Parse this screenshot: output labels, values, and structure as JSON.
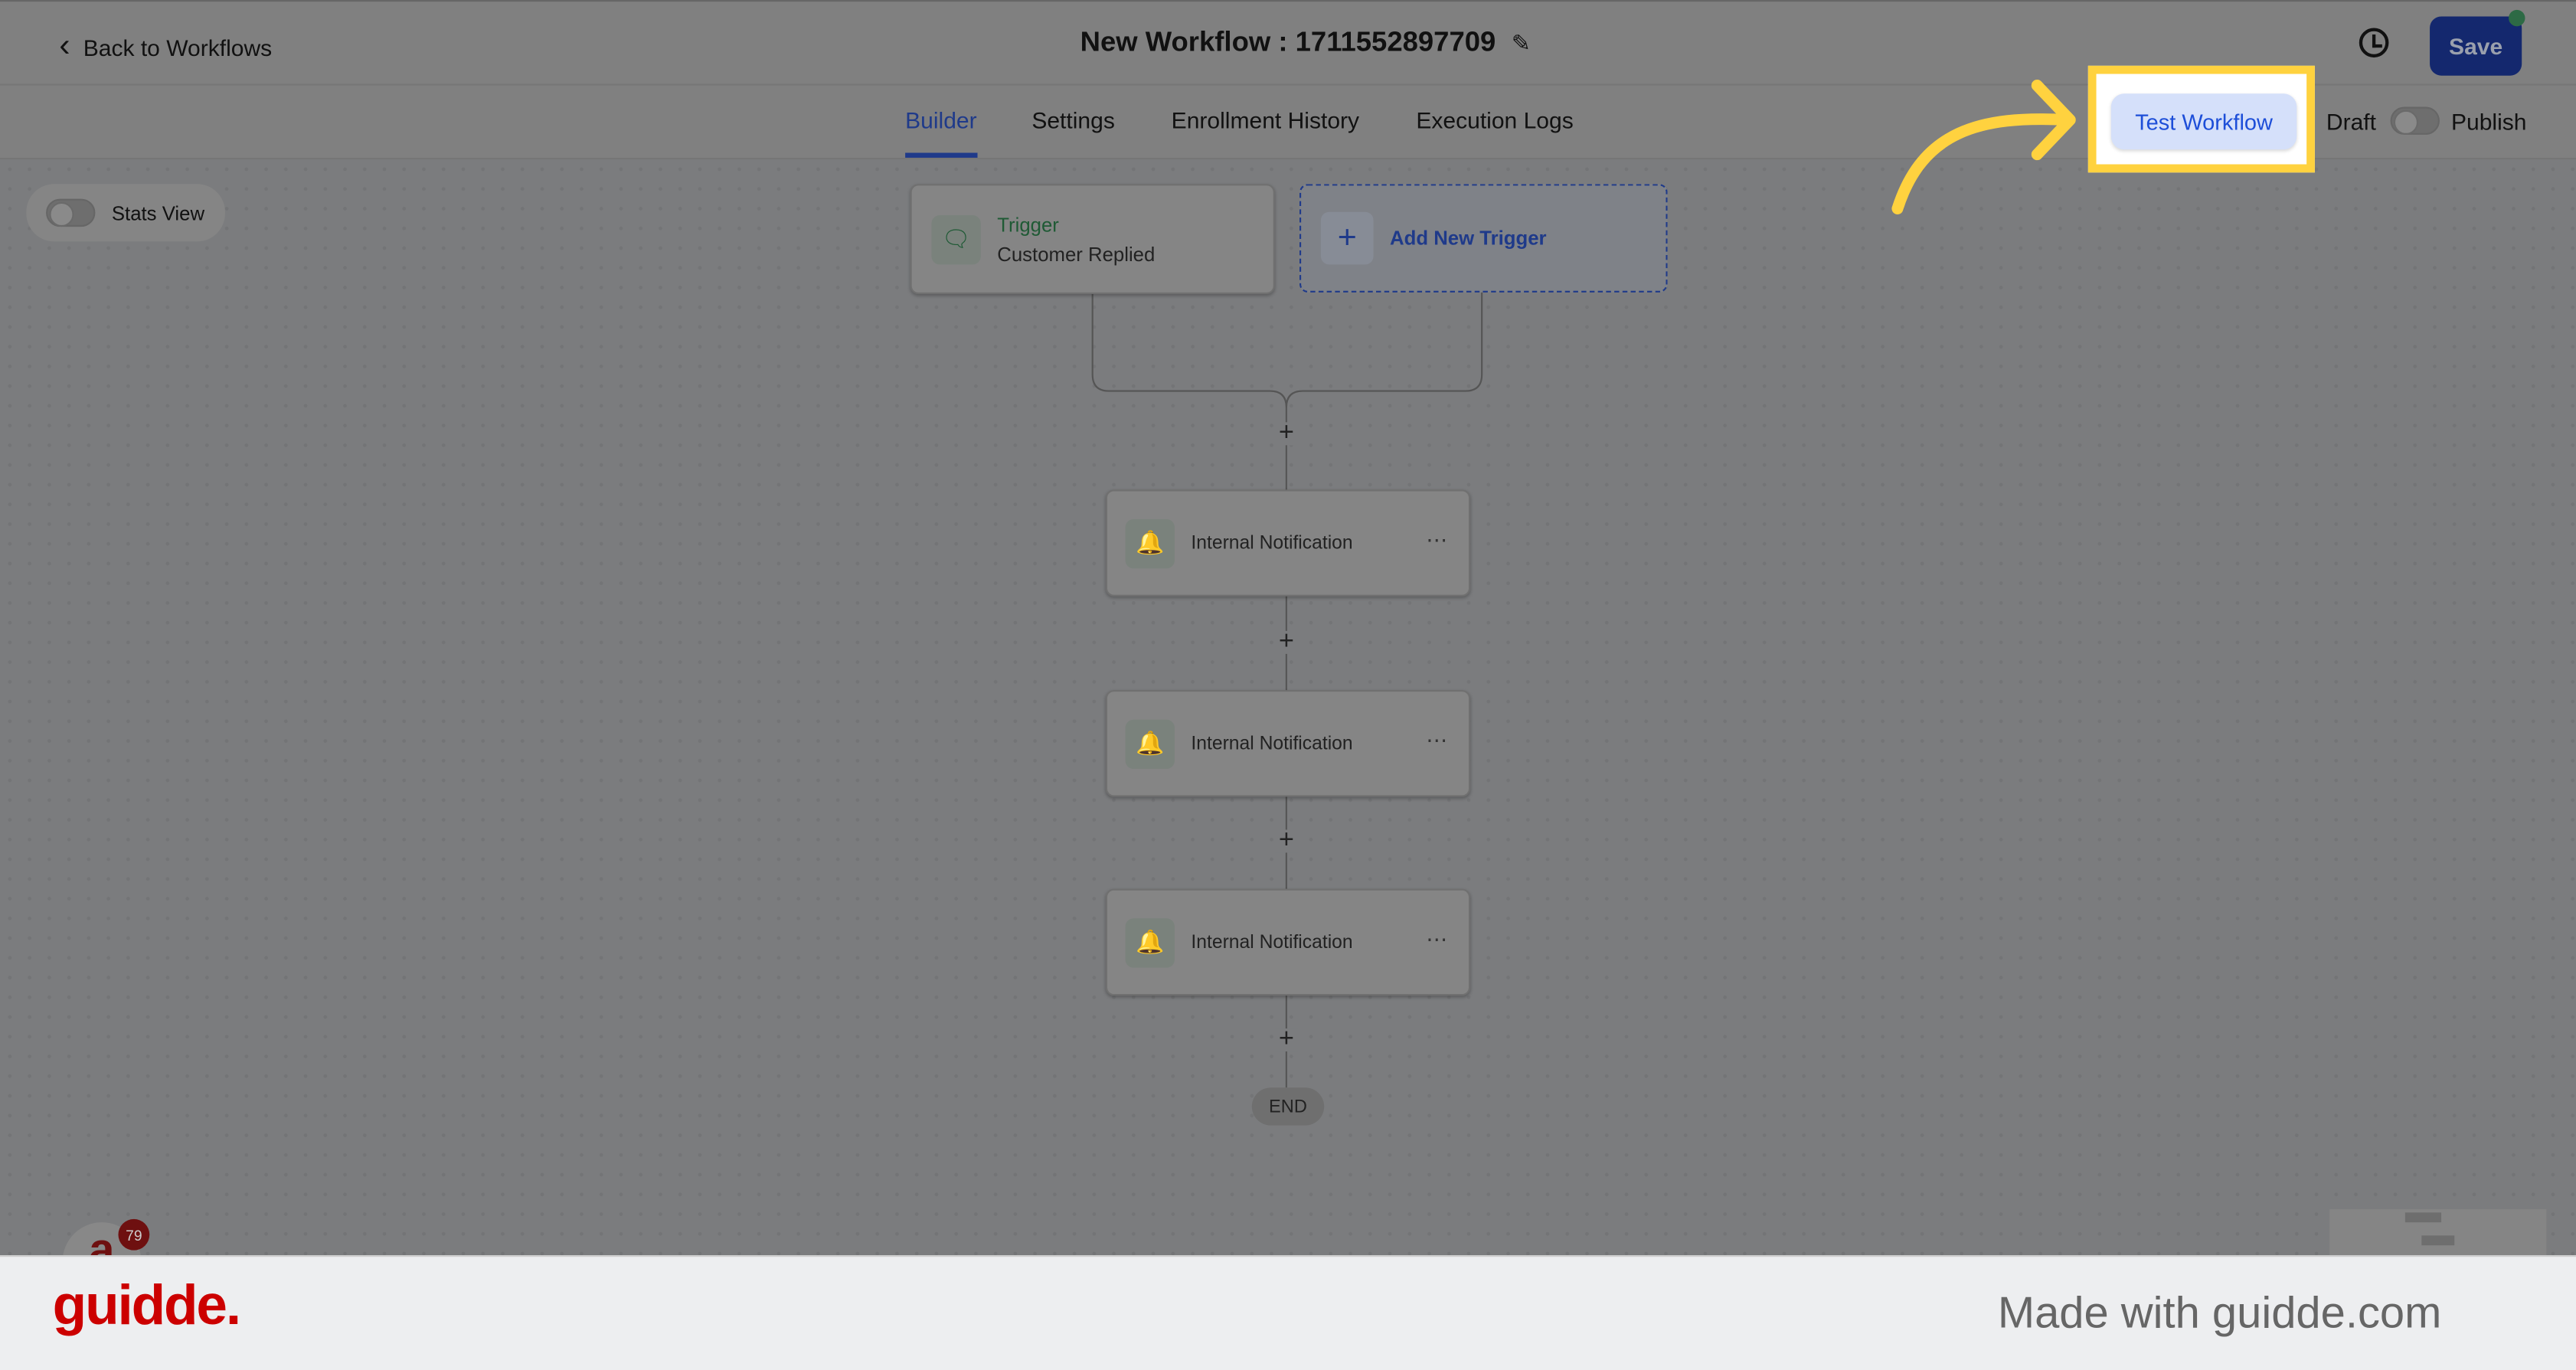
{
  "header": {
    "back_label": "Back to Workflows",
    "title": "New Workflow : 1711552897709",
    "save_label": "Save"
  },
  "tabs": [
    {
      "label": "Builder",
      "active": true
    },
    {
      "label": "Settings"
    },
    {
      "label": "Enrollment History"
    },
    {
      "label": "Execution Logs"
    }
  ],
  "actions": {
    "test_label": "Test Workflow",
    "draft_label": "Draft",
    "publish_label": "Publish",
    "published": false
  },
  "canvas": {
    "stats_label": "Stats View",
    "stats_on": false,
    "trigger": {
      "title": "Trigger",
      "subtitle": "Customer Replied",
      "icon": "chat-icon"
    },
    "add_trigger_label": "Add New Trigger",
    "actions": [
      {
        "label": "Internal Notification",
        "icon": "bell-icon"
      },
      {
        "label": "Internal Notification",
        "icon": "bell-icon"
      },
      {
        "label": "Internal Notification",
        "icon": "bell-icon"
      }
    ],
    "end_label": "END"
  },
  "widget": {
    "badge": "79"
  },
  "footer": {
    "logo": "guidde.",
    "tagline": "Made with guidde.com"
  },
  "colors": {
    "accent": "#1f3a8a",
    "highlight": "#ffd23f",
    "trigger_green": "#1f5a35",
    "brand_red": "#cc0000"
  }
}
